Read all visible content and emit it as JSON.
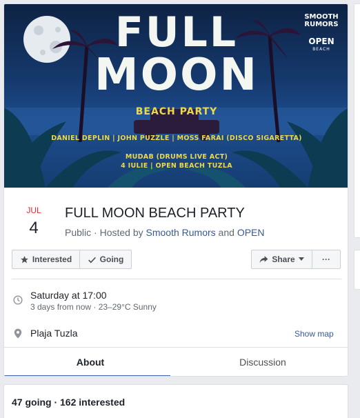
{
  "cover": {
    "title_line1": "FULL",
    "title_line2": "MOON",
    "subtitle": "BEACH PARTY",
    "brand_line1": "SMOOTH\nRUMORS",
    "brand_line2": "OPEN",
    "brand_line3": "BEACH",
    "lineup_1": "DANIEL DEPLIN | JOHN PUZZLE | MOSS FARAI (DISCO SIGARETTA)",
    "lineup_2": "MUDAB (DRUMS LIVE ACT)",
    "lineup_3": "4 IULIE | OPEN BEACH TUZLA"
  },
  "event": {
    "month": "JUL",
    "day": "4",
    "title": "FULL MOON BEACH PARTY",
    "privacy": "Public",
    "hosted_prefix": " · Hosted by ",
    "host1": "Smooth Rumors",
    "host_and": " and ",
    "host2": "OPEN"
  },
  "actions": {
    "interested": "Interested",
    "going": "Going",
    "share": "Share",
    "more": "···"
  },
  "details": {
    "time_main": "Saturday at 17:00",
    "time_sub": "3 days from now · 23–29°C Sunny",
    "place": "Plaja Tuzla",
    "show_map": "Show map"
  },
  "tabs": {
    "about": "About",
    "discussion": "Discussion"
  },
  "stats": {
    "text": "47 going · 162 interested"
  },
  "icons": {
    "interested": "star-icon",
    "going": "checkmark-icon",
    "share": "share-arrow-icon",
    "share_menu": "caret-down-icon",
    "time": "clock-icon",
    "place": "map-pin-icon"
  },
  "colors": {
    "month": "#e9272f",
    "link": "#365899",
    "tab_active": "#4267b2",
    "cover_text_yellow": "#ecd94a"
  }
}
